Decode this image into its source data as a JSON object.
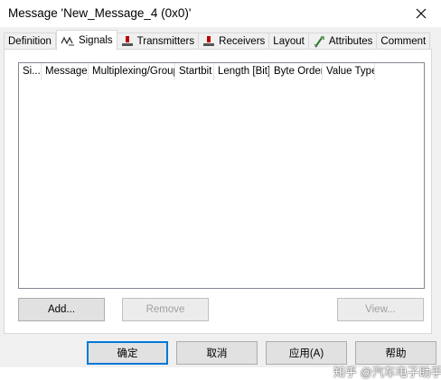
{
  "window": {
    "title": "Message 'New_Message_4 (0x0)'"
  },
  "tabs": [
    {
      "label": "Definition"
    },
    {
      "label": "Signals"
    },
    {
      "label": "Transmitters"
    },
    {
      "label": "Receivers"
    },
    {
      "label": "Layout"
    },
    {
      "label": "Attributes"
    },
    {
      "label": "Comment"
    }
  ],
  "signals_table": {
    "columns": [
      "Si...",
      "Message",
      "Multiplexing/Group",
      "Startbit",
      "Length [Bit]",
      "Byte Order",
      "Value Type"
    ]
  },
  "panel_buttons": {
    "add": "Add...",
    "remove": "Remove",
    "view": "View..."
  },
  "dialog_buttons": {
    "ok": "确定",
    "cancel": "取消",
    "apply": "应用(A)",
    "help": "帮助"
  },
  "watermark": "知乎 @汽车电子助手",
  "colors": {
    "accent": "#0078d7",
    "tab_icon_red": "#c00000"
  }
}
